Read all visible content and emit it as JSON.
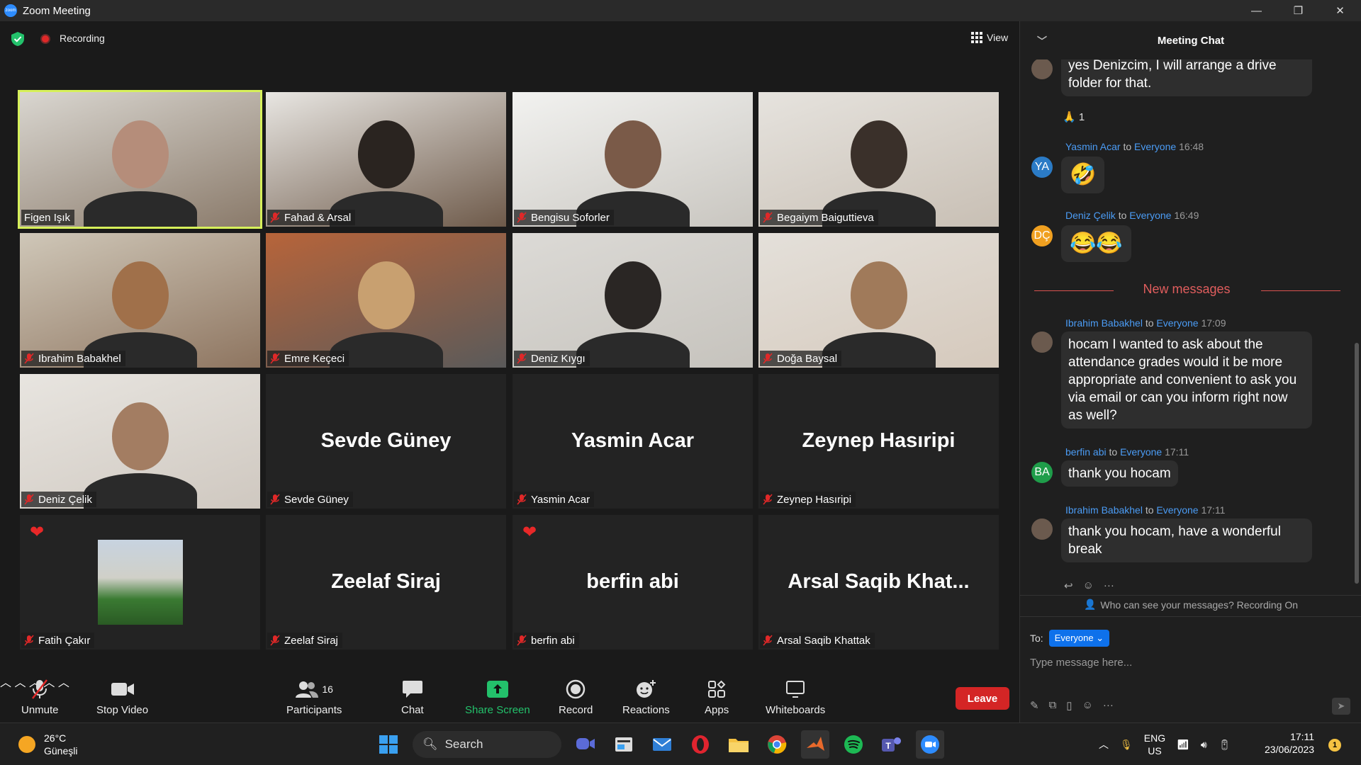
{
  "window": {
    "title": "Zoom Meeting",
    "minimize": "—",
    "maximize": "❐",
    "close": "✕"
  },
  "topbar": {
    "recording_label": "Recording",
    "view_label": "View"
  },
  "participants": [
    {
      "name": "Figen Işık",
      "video": true
    },
    {
      "name": "Fahad & Arsal",
      "video": true
    },
    {
      "name": "Bengisu Soforler",
      "video": true
    },
    {
      "name": "Begaiym Baiguttieva",
      "video": true
    },
    {
      "name": "Ibrahim Babakhel",
      "video": true
    },
    {
      "name": "Emre Keçeci",
      "video": true
    },
    {
      "name": "Deniz Kıygı",
      "video": true
    },
    {
      "name": "Doğa Baysal",
      "video": true
    },
    {
      "name": "Deniz Çelik",
      "video": true
    },
    {
      "name": "Sevde Güney",
      "video": false,
      "display": "Sevde Güney"
    },
    {
      "name": "Yasmin Acar",
      "video": false,
      "display": "Yasmin Acar"
    },
    {
      "name": "Zeynep Hasıripi",
      "video": false,
      "display": "Zeynep Hasıripi"
    },
    {
      "name": "Fatih Çakır",
      "video": true
    },
    {
      "name": "Zeelaf Siraj",
      "video": false,
      "display": "Zeelaf Siraj"
    },
    {
      "name": "berfin abi",
      "video": false,
      "display": "berfin abi"
    },
    {
      "name": "Arsal Saqib Khattak",
      "video": false,
      "display": "Arsal Saqib Khat..."
    }
  ],
  "toolbar": {
    "unmute": "Unmute",
    "stop_video": "Stop Video",
    "participants": "Participants",
    "participants_count": "16",
    "chat": "Chat",
    "share_screen": "Share Screen",
    "record": "Record",
    "reactions": "Reactions",
    "apps": "Apps",
    "whiteboards": "Whiteboards",
    "leave": "Leave"
  },
  "chat": {
    "title": "Meeting Chat",
    "new_messages": "New messages",
    "messages": [
      {
        "sender": "",
        "text": "yes Denizcim, I will arrange a drive folder for that.",
        "reaction": "🙏 1"
      },
      {
        "sender": "Yasmin Acar",
        "to": "to",
        "audience": "Everyone",
        "time": "16:48",
        "initials": "YA",
        "text": "🤣"
      },
      {
        "sender": "Deniz Çelik",
        "to": "to",
        "audience": "Everyone",
        "time": "16:49",
        "initials": "DÇ",
        "text": "😂😂"
      },
      {
        "sender": "Ibrahim Babakhel",
        "to": "to",
        "audience": "Everyone",
        "time": "17:09",
        "text": "hocam I wanted to ask about the attendance grades would it be more appropriate and convenient to ask you via email or can you inform right now as well?"
      },
      {
        "sender": "berfin abi",
        "to": "to",
        "audience": "Everyone",
        "time": "17:11",
        "initials": "BA",
        "text": "thank you hocam"
      },
      {
        "sender": "Ibrahim Babakhel",
        "to": "to",
        "audience": "Everyone",
        "time": "17:11",
        "text": "thank you hocam, have a wonderful break"
      }
    ],
    "visibility_note": "Who can see your messages? Recording On",
    "to_label": "To:",
    "to_value": "Everyone",
    "input_placeholder": "Type message here...",
    "more": "···"
  },
  "taskbar": {
    "temperature": "26°C",
    "weather": "Güneşli",
    "search": "Search",
    "language": "ENG",
    "region": "US",
    "time": "17:11",
    "date": "23/06/2023",
    "notifications": "1"
  },
  "colors": {
    "accent": "#0e71eb",
    "active_speaker": "#d6f05a",
    "leave": "#d42525",
    "share": "#23c16b",
    "new_messages": "#e05d5d"
  }
}
